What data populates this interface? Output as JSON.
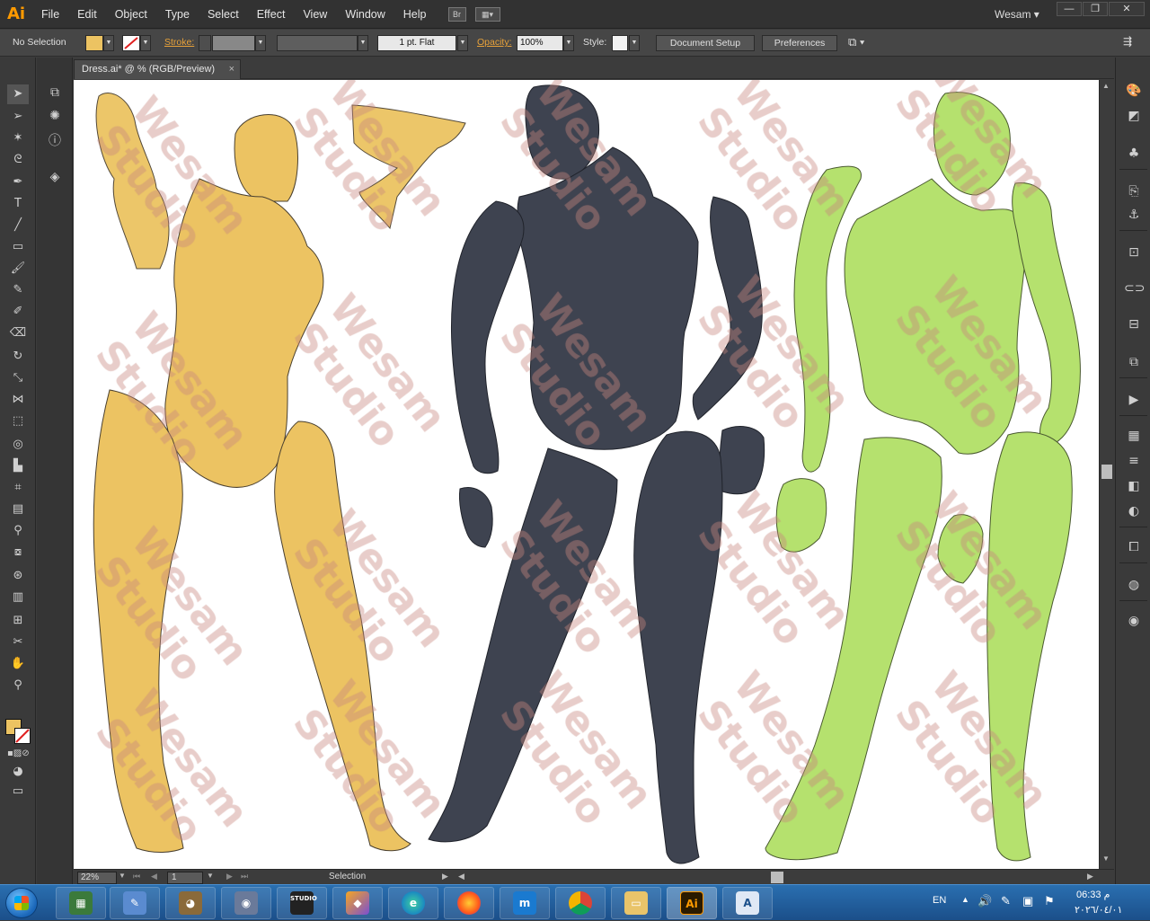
{
  "app": {
    "logo": "Ai",
    "user": "Wesam"
  },
  "menu": [
    "File",
    "Edit",
    "Object",
    "Type",
    "Select",
    "Effect",
    "View",
    "Window",
    "Help"
  ],
  "menubar_buttons": {
    "bridge": "Br"
  },
  "window_controls": {
    "minimize": "—",
    "restore": "❐",
    "close": "✕"
  },
  "control": {
    "selection": "No Selection",
    "stroke_label": "Stroke:",
    "stroke_profile": "1 pt. Flat",
    "opacity_label": "Opacity:",
    "opacity_value": "100%",
    "style_label": "Style:",
    "document_setup": "Document Setup",
    "preferences": "Preferences"
  },
  "document": {
    "tab_title": "Dress.ai* @ % (RGB/Preview)",
    "close": "×"
  },
  "canvas": {
    "watermark_line1": "Wesam",
    "watermark_line2": "Studio",
    "colors": {
      "figure_left": "#ecc362",
      "figure_middle": "#3e4350",
      "figure_right": "#b5e16e",
      "outline": "#3a3a2a"
    }
  },
  "statusbar": {
    "zoom": "22%",
    "page": "1",
    "label": "Selection"
  },
  "tools": [
    "selection-tool",
    "direct-selection-tool",
    "magic-wand-tool",
    "lasso-tool",
    "pen-tool",
    "type-tool",
    "line-tool",
    "rectangle-tool",
    "paintbrush-tool",
    "pencil-tool",
    "blob-brush-tool",
    "eraser-tool",
    "rotate-tool",
    "scale-tool",
    "width-tool",
    "free-transform-tool",
    "shape-builder-tool",
    "perspective-grid-tool",
    "mesh-tool",
    "gradient-tool",
    "eyedropper-tool",
    "blend-tool",
    "symbol-sprayer-tool",
    "column-graph-tool",
    "artboard-tool",
    "slice-tool",
    "hand-tool",
    "zoom-tool"
  ],
  "taskbar": {
    "apps": [
      "explorer-app",
      "paint-app",
      "gimp-app",
      "preview-app",
      "studio-app",
      "photos-app",
      "edge-app",
      "firefox-app",
      "mixer-app",
      "chrome-app",
      "folder-app",
      "illustrator-app",
      "word-app"
    ],
    "illustrator_label": "Ai",
    "studio_label": "STUDIO",
    "language": "EN",
    "time": "06:33 م",
    "date": "٢٠٢٦/٠٤/٠١"
  }
}
